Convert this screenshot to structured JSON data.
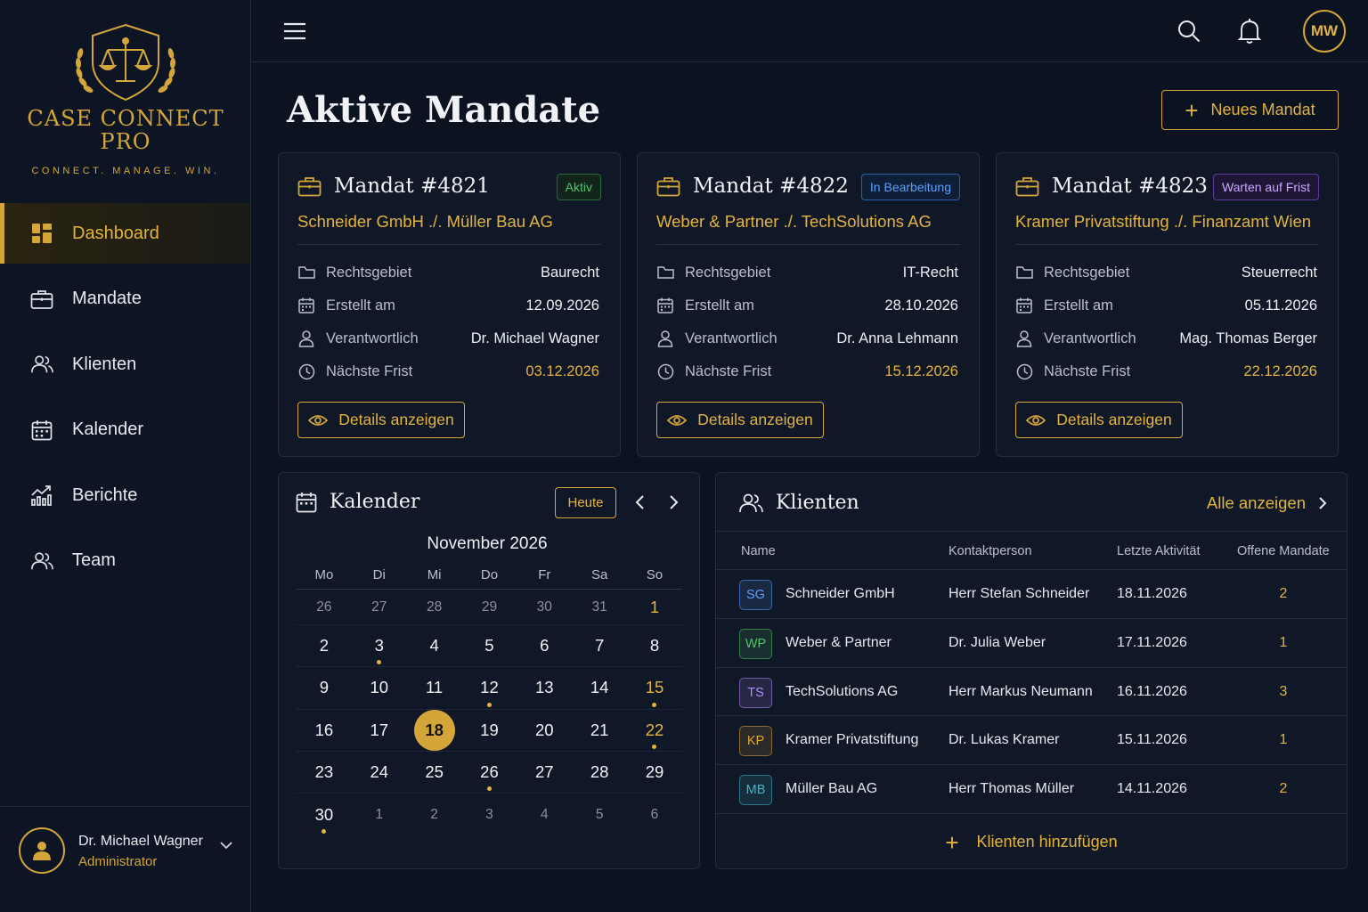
{
  "brand": {
    "name_line1": "CASE CONNECT",
    "name_line2": "PRO",
    "tagline": "CONNECT. MANAGE. WIN.",
    "accent_color": "#d4a63a",
    "logo_icon": "scales-of-justice-shield-laurel"
  },
  "sidebar": {
    "items": [
      {
        "label": "Dashboard",
        "icon": "dashboard-grid-icon",
        "active": true
      },
      {
        "label": "Mandate",
        "icon": "briefcase-icon"
      },
      {
        "label": "Klienten",
        "icon": "users-icon"
      },
      {
        "label": "Kalender",
        "icon": "calendar-icon"
      },
      {
        "label": "Berichte",
        "icon": "chart-icon"
      },
      {
        "label": "Team",
        "icon": "team-icon"
      }
    ],
    "user": {
      "name": "Dr. Michael Wagner",
      "role": "Administrator"
    }
  },
  "topbar": {
    "avatar_initials": "MW"
  },
  "page": {
    "title": "Aktive Mandate",
    "new_button": "Neues Mandat"
  },
  "cases": [
    {
      "title": "Mandat #4821",
      "status": "Aktiv",
      "status_color": "green",
      "parties": "Schneider GmbH ./. Müller Bau AG",
      "fields": [
        {
          "label": "Rechtsgebiet",
          "value": "Baurecht"
        },
        {
          "label": "Erstellt am",
          "value": "12.09.2026"
        },
        {
          "label": "Verantwortlich",
          "value": "Dr. Michael Wagner"
        },
        {
          "label": "Nächste Frist",
          "value": "03.12.2026"
        }
      ],
      "button": "Details anzeigen"
    },
    {
      "title": "Mandat #4822",
      "status": "In Bearbeitung",
      "status_color": "blue",
      "parties": "Weber & Partner ./. TechSolutions AG",
      "fields": [
        {
          "label": "Rechtsgebiet",
          "value": "IT-Recht"
        },
        {
          "label": "Erstellt am",
          "value": "28.10.2026"
        },
        {
          "label": "Verantwortlich",
          "value": "Dr. Anna Lehmann"
        },
        {
          "label": "Nächste Frist",
          "value": "15.12.2026"
        }
      ],
      "button": "Details anzeigen"
    },
    {
      "title": "Mandat #4823",
      "status": "Warten auf Frist",
      "status_color": "purple",
      "parties": "Kramer Privatstiftung ./. Finanzamt Wien",
      "fields": [
        {
          "label": "Rechtsgebiet",
          "value": "Steuerrecht"
        },
        {
          "label": "Erstellt am",
          "value": "05.11.2026"
        },
        {
          "label": "Verantwortlich",
          "value": "Mag. Thomas Berger"
        },
        {
          "label": "Nächste Frist",
          "value": "22.12.2026"
        }
      ],
      "button": "Details anzeigen"
    }
  ],
  "calendar": {
    "title": "Kalender",
    "today_button": "Heute",
    "month": "November 2026",
    "weekdays": [
      "Mo",
      "Di",
      "Mi",
      "Do",
      "Fr",
      "Sa",
      "So"
    ],
    "weeks": [
      [
        {
          "d": "26",
          "m": true
        },
        {
          "d": "27",
          "m": true
        },
        {
          "d": "28",
          "m": true
        },
        {
          "d": "29",
          "m": true
        },
        {
          "d": "30",
          "m": true
        },
        {
          "d": "31",
          "m": true
        },
        {
          "d": "1",
          "g": true
        }
      ],
      [
        {
          "d": "2"
        },
        {
          "d": "3",
          "dot": true
        },
        {
          "d": "4"
        },
        {
          "d": "5"
        },
        {
          "d": "6"
        },
        {
          "d": "7"
        },
        {
          "d": "8"
        }
      ],
      [
        {
          "d": "9"
        },
        {
          "d": "10"
        },
        {
          "d": "11"
        },
        {
          "d": "12",
          "dot": true
        },
        {
          "d": "13"
        },
        {
          "d": "14"
        },
        {
          "d": "15",
          "g": true,
          "dot": true
        }
      ],
      [
        {
          "d": "16"
        },
        {
          "d": "17"
        },
        {
          "d": "18",
          "sel": true
        },
        {
          "d": "19"
        },
        {
          "d": "20"
        },
        {
          "d": "21"
        },
        {
          "d": "22",
          "g": true,
          "dot": true
        }
      ],
      [
        {
          "d": "23"
        },
        {
          "d": "24"
        },
        {
          "d": "25"
        },
        {
          "d": "26",
          "dot": true
        },
        {
          "d": "27"
        },
        {
          "d": "28"
        },
        {
          "d": "29"
        }
      ],
      [
        {
          "d": "30",
          "dot": true
        },
        {
          "d": "1",
          "m": true
        },
        {
          "d": "2",
          "m": true
        },
        {
          "d": "3",
          "m": true
        },
        {
          "d": "4",
          "m": true
        },
        {
          "d": "5",
          "m": true
        },
        {
          "d": "6",
          "m": true
        }
      ]
    ]
  },
  "clients": {
    "title": "Klienten",
    "view_all": "Alle anzeigen",
    "columns": [
      "Name",
      "Kontaktperson",
      "Letzte Aktivität",
      "Offene Mandate"
    ],
    "rows": [
      {
        "initials": "SG",
        "name": "Schneider GmbH",
        "contact": "Herr Stefan Schneider",
        "last": "18.11.2026",
        "open": "2",
        "color": "#5aa0ff"
      },
      {
        "initials": "WP",
        "name": "Weber & Partner",
        "contact": "Dr. Julia Weber",
        "last": "17.11.2026",
        "open": "1",
        "color": "#52c36b"
      },
      {
        "initials": "TS",
        "name": "TechSolutions AG",
        "contact": "Herr Markus Neumann",
        "last": "16.11.2026",
        "open": "3",
        "color": "#b58cff"
      },
      {
        "initials": "KP",
        "name": "Kramer Privatstiftung",
        "contact": "Dr. Lukas Kramer",
        "last": "15.11.2026",
        "open": "1",
        "color": "#e2a53a"
      },
      {
        "initials": "MB",
        "name": "Müller Bau AG",
        "contact": "Herr Thomas Müller",
        "last": "14.11.2026",
        "open": "2",
        "color": "#3fb8c8"
      }
    ],
    "add_button": "Klienten hinzufügen"
  }
}
